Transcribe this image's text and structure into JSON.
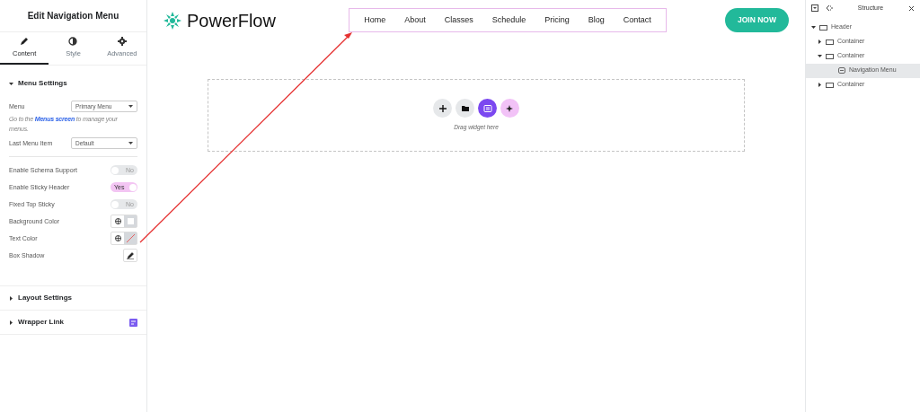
{
  "editor_panel": {
    "title": "Edit Navigation Menu",
    "tabs": [
      {
        "label": "Content",
        "kind": "pencil",
        "selected": true
      },
      {
        "label": "Style",
        "kind": "contrast",
        "selected": false
      },
      {
        "label": "Advanced",
        "kind": "gear",
        "selected": false
      }
    ],
    "sections": [
      {
        "title": "Menu Settings",
        "expanded": true,
        "controls": [
          {
            "kind": "select",
            "label": "Menu",
            "value": "Primary Menu"
          },
          {
            "kind": "note",
            "before": "Go to the",
            "link": "Menus screen",
            "after": "to manage your menus."
          },
          {
            "kind": "select",
            "label": "Last Menu Item",
            "value": "Default"
          },
          {
            "kind": "switch",
            "label": "Enable Schema Support",
            "on": false,
            "text": "No"
          },
          {
            "kind": "switch",
            "label": "Enable Sticky Header",
            "on": true,
            "text": "Yes"
          },
          {
            "kind": "switch",
            "label": "Fixed Top Sticky",
            "on": false,
            "text": "No"
          },
          {
            "kind": "color",
            "label": "Background Color",
            "color": "#ffffff"
          },
          {
            "kind": "color",
            "label": "Text Color"
          },
          {
            "kind": "shadow",
            "label": "Box Shadow"
          }
        ]
      },
      {
        "title": "Layout Settings",
        "expanded": false
      },
      {
        "title": "Wrapper Link",
        "expanded": false,
        "badge": true
      }
    ]
  },
  "canvas": {
    "logo": "PowerFlow",
    "nav_items": [
      "Home",
      "About",
      "Classes",
      "Schedule",
      "Pricing",
      "Blog",
      "Contact"
    ],
    "cta": "JOIN NOW",
    "drop_hint": "Drag widget here"
  },
  "structure": {
    "title": "Structure",
    "tree": [
      {
        "label": "Header",
        "expanded": true,
        "selected": false,
        "children": [
          {
            "label": "Container",
            "expanded": false,
            "selected": false
          },
          {
            "label": "Container",
            "expanded": true,
            "selected": false,
            "children": [
              {
                "label": "Navigation Menu",
                "kind": "widget",
                "selected": true
              }
            ]
          },
          {
            "label": "Container",
            "expanded": false,
            "selected": false
          }
        ]
      }
    ]
  }
}
